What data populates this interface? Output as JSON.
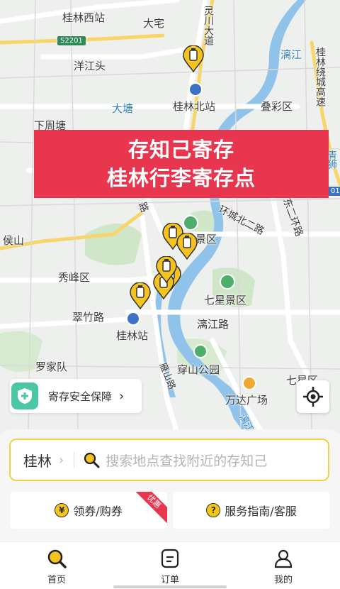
{
  "banner": {
    "line1": "存知己寄存",
    "line2": "桂林行李寄存点"
  },
  "map": {
    "labels": {
      "guilin_west": "桂林西站",
      "dazhai": "大宅",
      "lingchuan": "灵川大道",
      "lijiang": "漓江",
      "ring_highway": "桂林绕城高速",
      "yangjiangtou": "洋江头",
      "datang": "大塘",
      "guilin_north": "桂林北站",
      "diecai": "叠彩区",
      "xiazhoutang": "下周塘",
      "qinshi": "青狮",
      "houshan": "侯山",
      "north_ring": "环城北二路",
      "east_ring": "东二环路",
      "scenic": "景区",
      "xiufeng": "秀峰区",
      "qixing_scenic": "七星景区",
      "cuizhu": "翠竹路",
      "guilin_station": "桂林站",
      "lijiang_road": "漓江路",
      "luojiadui": "罗家队",
      "chuanshan": "穿山公园",
      "qixing": "七星区",
      "wanda": "万达广场",
      "lijiang_small": "漓江",
      "pi_road": "路",
      "yingshan": "雁山路"
    },
    "shields": {
      "s2201": "S2201",
      "g01": "01"
    }
  },
  "safety": {
    "label": "寄存安全保障",
    "icon": "shield-plus-icon"
  },
  "search": {
    "city": "桂林",
    "placeholder": "搜索地点查找附近的存知己"
  },
  "cards": {
    "coupon": {
      "label": "领券/购券",
      "icon": "yen-icon",
      "badge": "优惠"
    },
    "service": {
      "label": "服务指南/客服",
      "icon": "question-icon"
    }
  },
  "tabs": [
    {
      "label": "首页",
      "icon": "search-icon"
    },
    {
      "label": "订单",
      "icon": "order-icon"
    },
    {
      "label": "我的",
      "icon": "user-icon"
    }
  ],
  "colors": {
    "accent": "#f4d03f",
    "banner": "#e8364e",
    "safety": "#4cc7a6"
  }
}
